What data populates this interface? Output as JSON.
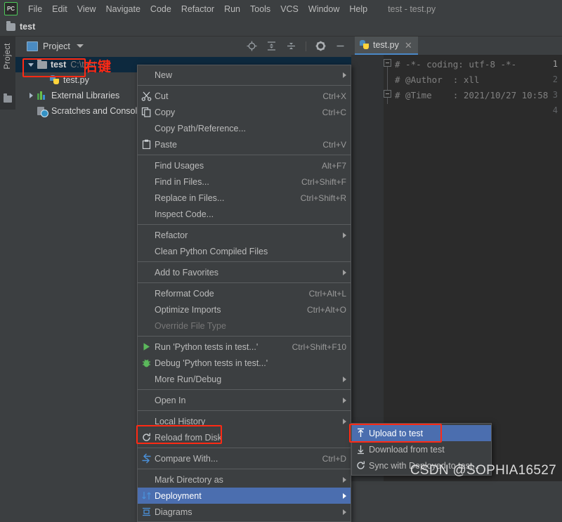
{
  "menubar": {
    "logo": "PC",
    "items": [
      "File",
      "Edit",
      "View",
      "Navigate",
      "Code",
      "Refactor",
      "Run",
      "Tools",
      "VCS",
      "Window",
      "Help"
    ],
    "window_title": "test - test.py"
  },
  "navbar": {
    "label": "test"
  },
  "toolstrip": {
    "label": "Project"
  },
  "project_panel": {
    "title": "Project",
    "tree": [
      {
        "name": "test",
        "sub": "C:\\test",
        "icon": "folder-icon",
        "twisty": "open",
        "selected": true,
        "indent": 0
      },
      {
        "name": "test.py",
        "sub": "",
        "icon": "python-file-icon",
        "twisty": "none",
        "selected": false,
        "indent": 1
      },
      {
        "name": "External Libraries",
        "sub": "",
        "icon": "library-icon",
        "twisty": "closed",
        "selected": false,
        "indent": 0
      },
      {
        "name": "Scratches and Consoles",
        "sub": "",
        "icon": "scratches-icon",
        "twisty": "none",
        "selected": false,
        "indent": 0
      }
    ]
  },
  "annotations": {
    "right_click_text": "右键",
    "accent_color": "#ff2a14"
  },
  "editor": {
    "tab": {
      "label": "test.py",
      "close": "✕"
    },
    "lines": [
      {
        "num": "1",
        "text": "# -*- coding: utf-8 -*-"
      },
      {
        "num": "2",
        "text": "# @Author  : xll"
      },
      {
        "num": "3",
        "text": "# @Time    : 2021/10/27 10:58"
      },
      {
        "num": "4",
        "text": ""
      }
    ]
  },
  "context_menu": {
    "items": [
      {
        "label": "New",
        "shortcut": "",
        "icon": "",
        "arrow": true,
        "sep_after": true
      },
      {
        "label": "Cut",
        "shortcut": "Ctrl+X",
        "icon": "scissors-icon",
        "arrow": false
      },
      {
        "label": "Copy",
        "shortcut": "Ctrl+C",
        "icon": "copy-icon",
        "arrow": false
      },
      {
        "label": "Copy Path/Reference...",
        "shortcut": "",
        "icon": "",
        "arrow": false
      },
      {
        "label": "Paste",
        "shortcut": "Ctrl+V",
        "icon": "paste-icon",
        "arrow": false,
        "sep_after": true
      },
      {
        "label": "Find Usages",
        "shortcut": "Alt+F7",
        "icon": "",
        "arrow": false
      },
      {
        "label": "Find in Files...",
        "shortcut": "Ctrl+Shift+F",
        "icon": "",
        "arrow": false
      },
      {
        "label": "Replace in Files...",
        "shortcut": "Ctrl+Shift+R",
        "icon": "",
        "arrow": false
      },
      {
        "label": "Inspect Code...",
        "shortcut": "",
        "icon": "",
        "arrow": false,
        "sep_after": true
      },
      {
        "label": "Refactor",
        "shortcut": "",
        "icon": "",
        "arrow": true
      },
      {
        "label": "Clean Python Compiled Files",
        "shortcut": "",
        "icon": "",
        "arrow": false,
        "sep_after": true
      },
      {
        "label": "Add to Favorites",
        "shortcut": "",
        "icon": "",
        "arrow": true,
        "sep_after": true
      },
      {
        "label": "Reformat Code",
        "shortcut": "Ctrl+Alt+L",
        "icon": "",
        "arrow": false
      },
      {
        "label": "Optimize Imports",
        "shortcut": "Ctrl+Alt+O",
        "icon": "",
        "arrow": false
      },
      {
        "label": "Override File Type",
        "shortcut": "",
        "icon": "",
        "arrow": false,
        "disabled": true,
        "sep_after": true
      },
      {
        "label": "Run 'Python tests in test...'",
        "shortcut": "Ctrl+Shift+F10",
        "icon": "run-icon",
        "arrow": false
      },
      {
        "label": "Debug 'Python tests in test...'",
        "shortcut": "",
        "icon": "debug-icon",
        "arrow": false
      },
      {
        "label": "More Run/Debug",
        "shortcut": "",
        "icon": "",
        "arrow": true,
        "sep_after": true
      },
      {
        "label": "Open In",
        "shortcut": "",
        "icon": "",
        "arrow": true,
        "sep_after": true
      },
      {
        "label": "Local History",
        "shortcut": "",
        "icon": "",
        "arrow": true
      },
      {
        "label": "Reload from Disk",
        "shortcut": "",
        "icon": "reload-icon",
        "arrow": false,
        "sep_after": true
      },
      {
        "label": "Compare With...",
        "shortcut": "Ctrl+D",
        "icon": "compare-icon",
        "arrow": false,
        "sep_after": true
      },
      {
        "label": "Mark Directory as",
        "shortcut": "",
        "icon": "",
        "arrow": true
      },
      {
        "label": "Deployment",
        "shortcut": "",
        "icon": "deployment-icon",
        "arrow": true,
        "selected": true
      },
      {
        "label": "Diagrams",
        "shortcut": "",
        "icon": "diagram-icon",
        "arrow": true
      }
    ]
  },
  "submenu": {
    "items": [
      {
        "label": "Upload to test",
        "icon": "upload-icon",
        "selected": true
      },
      {
        "label": "Download from test",
        "icon": "download-icon",
        "selected": false
      },
      {
        "label": "Sync with Deployed to test...",
        "icon": "sync-icon",
        "selected": false
      }
    ]
  },
  "watermark": {
    "text": "CSDN @SOPHIA16527"
  }
}
